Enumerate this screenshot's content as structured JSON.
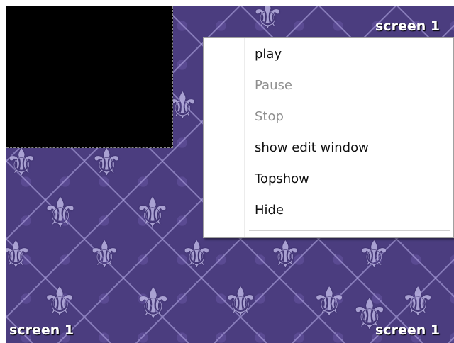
{
  "desktop": {
    "labels": {
      "top_right": "screen 1",
      "bottom_left": "screen 1",
      "bottom_right": "screen 1"
    }
  },
  "context_menu": {
    "items": [
      {
        "label": "play",
        "enabled": true
      },
      {
        "label": "Pause",
        "enabled": false
      },
      {
        "label": "Stop",
        "enabled": false
      },
      {
        "label": "show edit window",
        "enabled": true
      },
      {
        "label": "Topshow",
        "enabled": true
      },
      {
        "label": "Hide",
        "enabled": true
      }
    ]
  },
  "colors": {
    "background": "#4b3d7f",
    "pattern": "#b4acdc",
    "video_area": "#000000",
    "menu_background": "#ffffff",
    "menu_text": "#111111",
    "menu_disabled_text": "#8f8f8f"
  },
  "icons": {
    "pattern_motif": "fleur-de-lis-icon"
  }
}
